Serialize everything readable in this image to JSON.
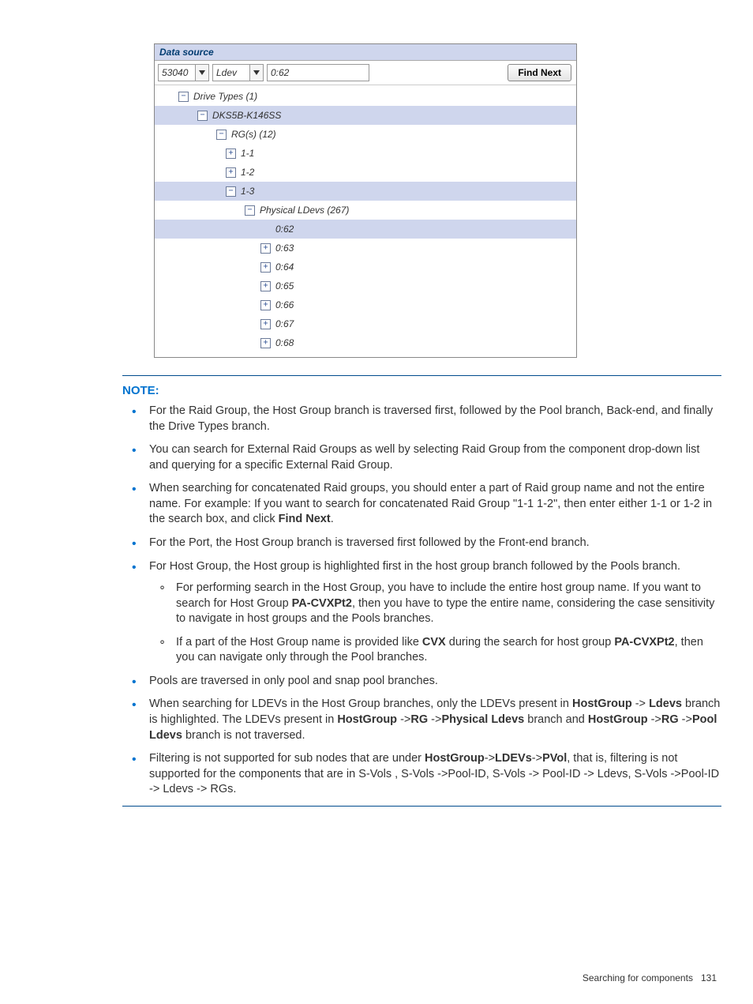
{
  "panel": {
    "title": "Data source",
    "combo1": "53040",
    "combo2": "Ldev",
    "search_value": "0:62",
    "find_label": "Find Next"
  },
  "tree": {
    "root": "Drive Types (1)",
    "drive": "DKS5B-K146SS",
    "rgs": "RG(s) (12)",
    "rg1": "1-1",
    "rg2": "1-2",
    "rg3": "1-3",
    "phys": "Physical LDevs (267)",
    "l62": "0:62",
    "l63": "0:63",
    "l64": "0:64",
    "l65": "0:65",
    "l66": "0:66",
    "l67": "0:67",
    "l68": "0:68"
  },
  "note": {
    "heading": "NOTE:",
    "items": [
      "For the Raid Group, the Host Group branch is traversed first, followed by the Pool branch, Back-end, and finally the Drive Types branch.",
      "You can search for External Raid Groups as well by selecting Raid Group from the component drop-down list and querying for a specific External Raid Group.",
      "When searching for concatenated Raid groups, you should enter a part of Raid group name and not the entire name. For example: If you want to search for concatenated Raid Group \"1-1 1-2\", then enter either 1-1 or 1-2 in the search box, and click ",
      "For the Port, the Host Group branch is traversed first followed by the Front-end branch.",
      "For Host Group, the Host group is highlighted first in the host group branch followed by the Pools branch.",
      "Pools are traversed in only pool and snap pool branches.",
      "When searching for LDEVs in the Host Group branches, only the LDEVs present in ",
      "Filtering is not supported for sub nodes that are under ",
      "Find Next",
      "For performing search in the Host Group, you have to include the entire host group name. If you want to search for Host Group ",
      ", then you have to type the entire name, considering the case sensitivity to navigate in host groups and the Pools branches.",
      "If a part of the Host Group name is provided like ",
      " during the search for host group ",
      ", then you can navigate only through the Pool branches.",
      " branch is highlighted. The LDEVs present in ",
      " branch and ",
      " branch is not traversed.",
      ", that is, filtering is not supported for the components that are in S-Vols , S-Vols ->Pool-ID, S-Vols -> Pool-ID -> Ldevs, S-Vols ->Pool-ID -> Ldevs -> RGs."
    ],
    "bold": {
      "findnext": "Find Next",
      "pacvx": "PA-CVXPt2",
      "cvx": "CVX",
      "hg": "HostGroup",
      "ldevs": "Ldevs",
      "rg": "RG",
      "physldevs": "Physical Ldevs",
      "poolldevs": "Pool Ldevs",
      "ldevs2": "LDEVs",
      "pvol": "PVol"
    }
  },
  "footer": {
    "section": "Searching for components",
    "page": "131"
  }
}
